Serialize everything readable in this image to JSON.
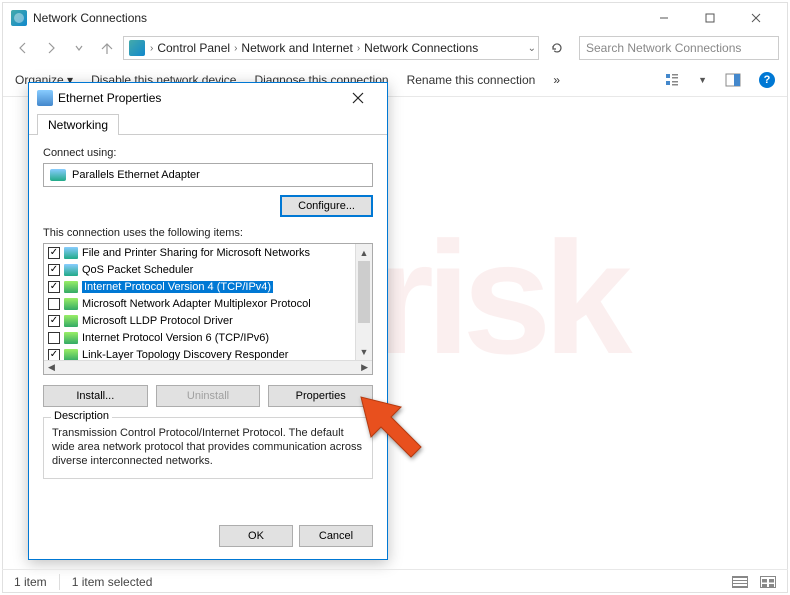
{
  "window": {
    "title": "Network Connections",
    "breadcrumb": [
      "Control Panel",
      "Network and Internet",
      "Network Connections"
    ],
    "search_placeholder": "Search Network Connections",
    "toolbar": {
      "organize": "Organize ▾",
      "disable": "Disable this network device",
      "diagnose": "Diagnose this connection",
      "rename": "Rename this connection",
      "more": "»"
    },
    "status": {
      "count": "1 item",
      "selected": "1 item selected"
    }
  },
  "dialog": {
    "title": "Ethernet Properties",
    "tab": "Networking",
    "connect_label": "Connect using:",
    "adapter": "Parallels Ethernet Adapter",
    "configure": "Configure...",
    "items_label": "This connection uses the following items:",
    "items": [
      {
        "checked": true,
        "label": "File and Printer Sharing for Microsoft Networks",
        "alt": true
      },
      {
        "checked": true,
        "label": "QoS Packet Scheduler",
        "alt": true
      },
      {
        "checked": true,
        "label": "Internet Protocol Version 4 (TCP/IPv4)",
        "sel": true
      },
      {
        "checked": false,
        "label": "Microsoft Network Adapter Multiplexor Protocol"
      },
      {
        "checked": true,
        "label": "Microsoft LLDP Protocol Driver"
      },
      {
        "checked": false,
        "label": "Internet Protocol Version 6 (TCP/IPv6)"
      },
      {
        "checked": true,
        "label": "Link-Layer Topology Discovery Responder"
      }
    ],
    "install": "Install...",
    "uninstall": "Uninstall",
    "properties": "Properties",
    "desc_label": "Description",
    "desc_text": "Transmission Control Protocol/Internet Protocol. The default wide area network protocol that provides communication across diverse interconnected networks.",
    "ok": "OK",
    "cancel": "Cancel"
  }
}
